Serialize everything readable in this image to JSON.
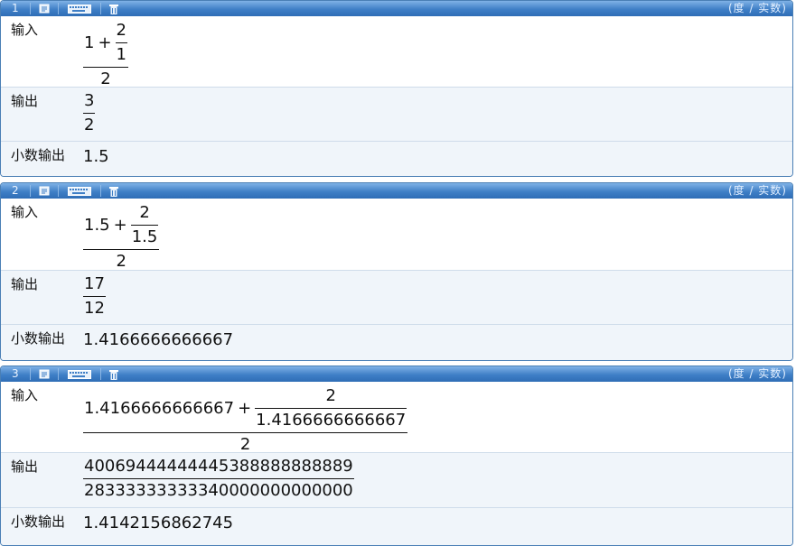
{
  "header": {
    "mode_label": "(度 / 实数)"
  },
  "labels": {
    "input": "输入",
    "output": "输出",
    "decimal_output": "小数输出"
  },
  "cells": [
    {
      "index": "1",
      "input": {
        "a": "1",
        "op": "+",
        "inner_num": "2",
        "inner_den": "1",
        "den": "2"
      },
      "output": {
        "num": "3",
        "den": "2"
      },
      "decimal": "1.5"
    },
    {
      "index": "2",
      "input": {
        "a": "1.5",
        "op": "+",
        "inner_num": "2",
        "inner_den": "1.5",
        "den": "2"
      },
      "output": {
        "num": "17",
        "den": "12"
      },
      "decimal": "1.4166666666667"
    },
    {
      "index": "3",
      "input": {
        "a": "1.4166666666667",
        "op": "+",
        "inner_num": "2",
        "inner_den": "1.4166666666667",
        "den": "2"
      },
      "output": {
        "num": "40069444444445388888888889",
        "den": "28333333333340000000000000"
      },
      "decimal": "1.4142156862745"
    }
  ]
}
